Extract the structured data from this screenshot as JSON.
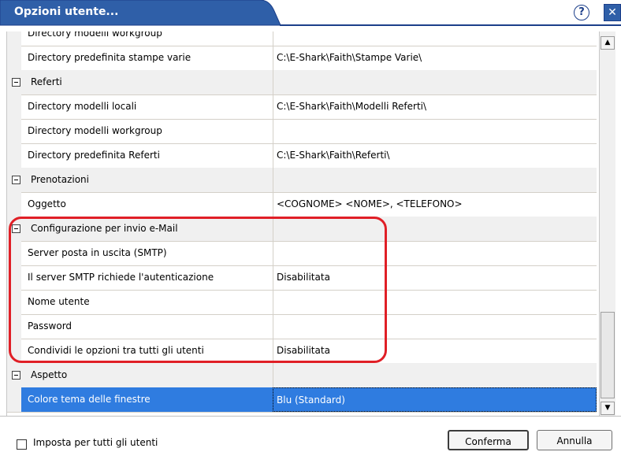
{
  "window": {
    "title": "Opzioni utente...",
    "help_glyph": "?",
    "close_glyph": "✕"
  },
  "grid": {
    "rows": [
      {
        "type": "property",
        "name": "Directory modelli workgroup",
        "value": ""
      },
      {
        "type": "property",
        "name": "Directory predefinita stampe varie",
        "value": "C:\\E-Shark\\Faith\\Stampe Varie\\"
      },
      {
        "type": "category",
        "name": "Referti",
        "value": ""
      },
      {
        "type": "property",
        "name": "Directory modelli locali",
        "value": "C:\\E-Shark\\Faith\\Modelli Referti\\"
      },
      {
        "type": "property",
        "name": "Directory modelli workgroup",
        "value": ""
      },
      {
        "type": "property",
        "name": "Directory predefinita Referti",
        "value": "C:\\E-Shark\\Faith\\Referti\\"
      },
      {
        "type": "category",
        "name": "Prenotazioni",
        "value": ""
      },
      {
        "type": "property",
        "name": "Oggetto",
        "value": "<COGNOME> <NOME>, <TELEFONO>"
      },
      {
        "type": "category",
        "name": "Configurazione per invio e-Mail",
        "value": ""
      },
      {
        "type": "property",
        "name": "Server posta in uscita (SMTP)",
        "value": ""
      },
      {
        "type": "property",
        "name": "Il server SMTP richiede l'autenticazione",
        "value": "Disabilitata"
      },
      {
        "type": "property",
        "name": "Nome utente",
        "value": ""
      },
      {
        "type": "property",
        "name": "Password",
        "value": ""
      },
      {
        "type": "property",
        "name": "Condividi le opzioni tra tutti gli utenti",
        "value": "Disabilitata"
      },
      {
        "type": "category",
        "name": "Aspetto",
        "value": ""
      },
      {
        "type": "property",
        "name": "Colore tema delle finestre",
        "value": "Blu (Standard)",
        "selected": true
      }
    ]
  },
  "scrollbar": {
    "up_glyph": "▲",
    "down_glyph": "▼"
  },
  "footer": {
    "checkbox_label": "Imposta per tutti gli utenti",
    "confirm_label": "Conferma",
    "cancel_label": "Annulla"
  },
  "colors": {
    "title_bar": "#2f5fa8",
    "selection": "#2f7ce0",
    "highlight": "#e01f26"
  }
}
